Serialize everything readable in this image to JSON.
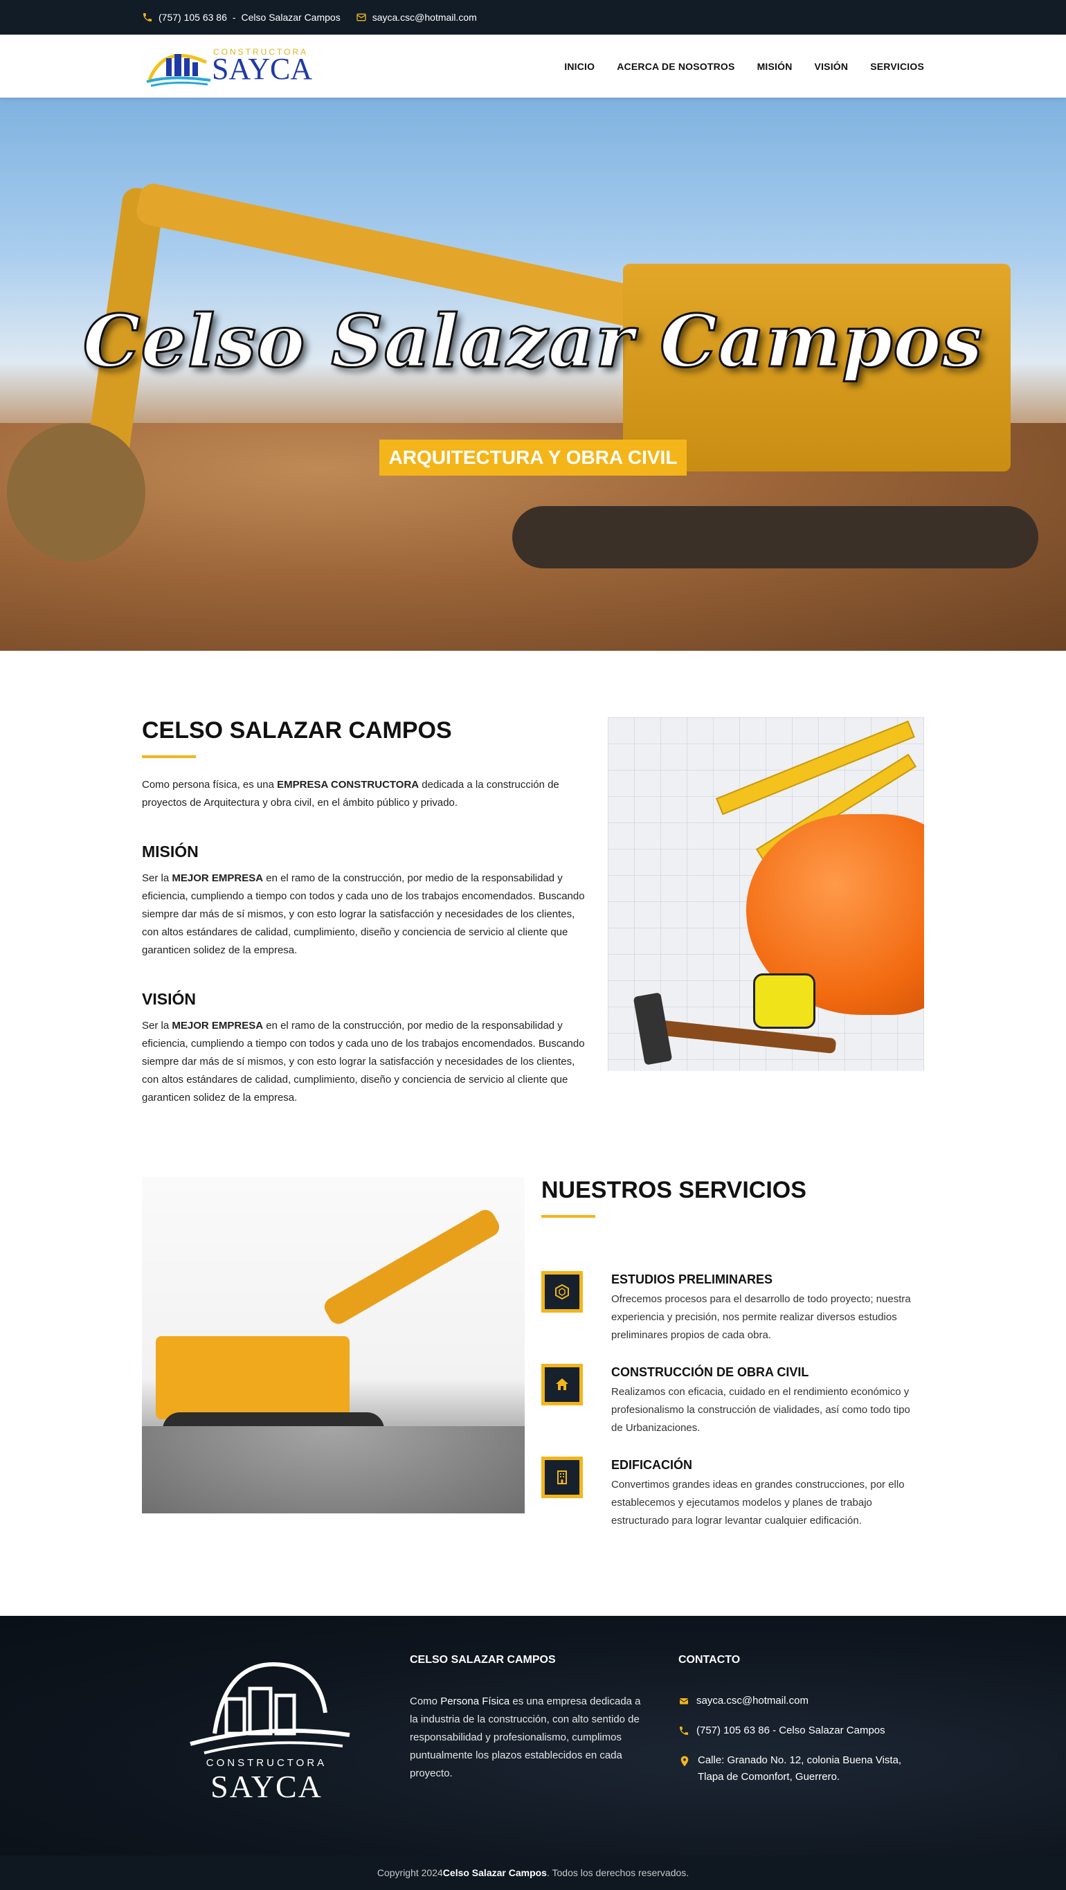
{
  "colors": {
    "accent": "#f2b51b",
    "dark": "#111c27",
    "brand_blue": "#1f3aa5"
  },
  "topbar": {
    "phone": "(757) 105 63 86",
    "separator": "-",
    "owner": "Celso Salazar Campos",
    "email": "sayca.csc@hotmail.com"
  },
  "logo": {
    "top": "CONSTRUCTORA",
    "name": "SAYCA"
  },
  "nav": {
    "items": [
      "INICIO",
      "ACERCA DE NOSOTROS",
      "MISIÓN",
      "VISIÓN",
      "SERVICIOS"
    ]
  },
  "hero": {
    "title": "Celso Salazar Campos",
    "badge": "ARQUITECTURA Y OBRA CIVIL"
  },
  "about": {
    "title": "CELSO SALAZAR CAMPOS",
    "intro_pre": "Como persona física, es una ",
    "intro_bold": "EMPRESA CONSTRUCTORA",
    "intro_post": " dedicada a la construcción de proyectos de Arquitectura y obra civil, en el ámbito público y privado.",
    "mision_title": "MISIÓN",
    "mision_pre": "Ser la ",
    "mision_bold": "MEJOR EMPRESA",
    "mision_post": " en el ramo de la construcción, por medio de la responsabilidad y eficiencia, cumpliendo a tiempo con todos y cada uno de los trabajos encomendados. Buscando siempre dar más de sí mismos, y con esto lograr la satisfacción y necesidades de los clientes, con altos estándares de calidad, cumplimiento, diseño y conciencia de servicio al cliente que garanticen solidez de la empresa.",
    "vision_title": "VISIÓN",
    "vision_pre": "Ser la ",
    "vision_bold": "MEJOR EMPRESA",
    "vision_post": " en el ramo de la construcción, por medio de la responsabilidad y eficiencia, cumpliendo a tiempo con todos y cada uno de los trabajos encomendados. Buscando siempre dar más de sí mismos, y con esto lograr la satisfacción y necesidades de los clientes, con altos estándares de calidad, cumplimiento, diseño y conciencia de servicio al cliente que garanticen solidez de la empresa."
  },
  "services": {
    "title": "NUESTROS SERVICIOS",
    "items": [
      {
        "icon": "hexagon-icon",
        "title": "ESTUDIOS PRELIMINARES",
        "text": "Ofrecemos procesos para el desarrollo de todo proyecto; nuestra experiencia y precisión, nos permite realizar diversos estudios preliminares propios de cada obra."
      },
      {
        "icon": "home-icon",
        "title": "CONSTRUCCIÓN DE OBRA CIVIL",
        "text": "Realizamos con eficacia, cuidado en el rendimiento económico y profesionalismo la construcción de vialidades, así como todo tipo de Urbanizaciones."
      },
      {
        "icon": "building-icon",
        "title": "EDIFICACIÓN",
        "text": "Convertimos grandes ideas en grandes construcciones, por ello establecemos y ejecutamos modelos y planes de trabajo estructurado para lograr levantar cualquier edificación."
      }
    ]
  },
  "footer": {
    "logo_top": "CONSTRUCTORA",
    "logo_name": "SAYCA",
    "about_title": "CELSO SALAZAR CAMPOS",
    "about_pre": "Como ",
    "about_bold": "Persona Física",
    "about_post": " es una empresa dedicada a la industria de la construcción, con alto sentido de responsabilidad y profesionalismo, cumplimos puntualmente los plazos establecidos en cada proyecto.",
    "contact_title": "CONTACTO",
    "email": "sayca.csc@hotmail.com",
    "phone": "(757) 105 63 86 - Celso Salazar Campos",
    "address": "Calle: Granado No. 12, colonia Buena Vista, Tlapa de Comonfort, Guerrero."
  },
  "copyright": {
    "pre": "Copyright 2024 ",
    "bold": "Celso Salazar Campos",
    "post": ". Todos los derechos reservados."
  }
}
